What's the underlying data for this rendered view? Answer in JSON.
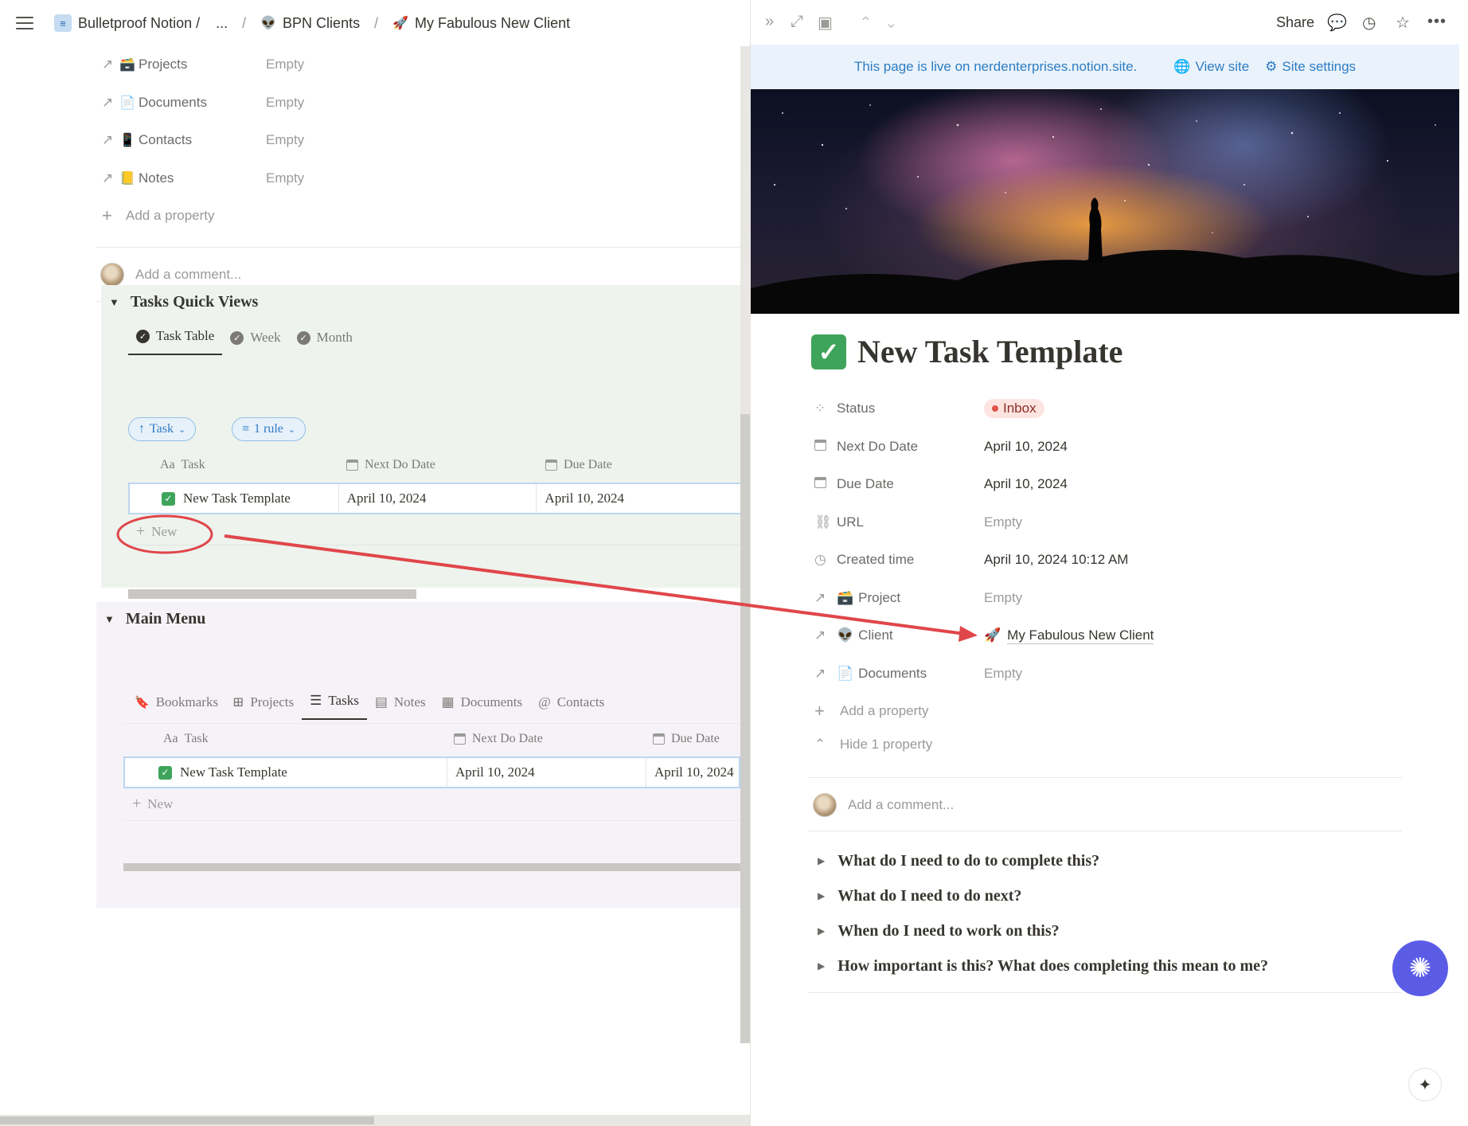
{
  "topbar": {
    "breadcrumbs": [
      {
        "label": "Bulletproof Notion /",
        "icon": "database-icon"
      },
      {
        "label": "...",
        "icon": ""
      },
      {
        "label": "BPN Clients",
        "icon": "alien-icon"
      },
      {
        "label": "My Fabulous New Client",
        "icon": "rocket-icon"
      }
    ],
    "separator": "/"
  },
  "left": {
    "properties": [
      {
        "emoji": "🗃️",
        "label": "Projects",
        "value": "Empty"
      },
      {
        "emoji": "📄",
        "label": "Documents",
        "value": "Empty"
      },
      {
        "emoji": "📱",
        "label": "Contacts",
        "value": "Empty"
      },
      {
        "emoji": "📒",
        "label": "Notes",
        "value": "Empty"
      }
    ],
    "add_property": "Add a property",
    "comment_placeholder": "Add a comment...",
    "tasks_quick_views": {
      "title": "Tasks Quick Views",
      "tabs": [
        "Task Table",
        "Week",
        "Month"
      ],
      "sort_pill": "Task",
      "filter_pill": "1 rule",
      "columns": [
        "Task",
        "Next Do Date",
        "Due Date"
      ],
      "rows": [
        {
          "task": "New Task Template",
          "next_do": "April 10, 2024",
          "due": "April 10, 2024"
        }
      ],
      "new_label": "New"
    },
    "main_menu": {
      "title": "Main Menu",
      "tabs": [
        "Bookmarks",
        "Projects",
        "Tasks",
        "Notes",
        "Documents",
        "Contacts"
      ],
      "columns": [
        "Task",
        "Next Do Date",
        "Due Date"
      ],
      "rows": [
        {
          "task": "New Task Template",
          "next_do": "April 10, 2024",
          "due": "April 10, 2024"
        }
      ],
      "new_label": "New"
    }
  },
  "right": {
    "share": "Share",
    "banner_text": "This page is live on nerdenterprises.notion.site.",
    "view_site": "View site",
    "site_settings": "Site settings",
    "title": "New Task Template",
    "properties": [
      {
        "icon": "status-icon",
        "glyph": "⁘",
        "label": "Status",
        "value": "Inbox",
        "kind": "status"
      },
      {
        "icon": "calendar-icon",
        "glyph": "",
        "label": "Next Do Date",
        "value": "April 10, 2024",
        "kind": "text"
      },
      {
        "icon": "calendar-icon",
        "glyph": "",
        "label": "Due Date",
        "value": "April 10, 2024",
        "kind": "text"
      },
      {
        "icon": "link-icon",
        "glyph": "🔗",
        "label": "URL",
        "value": "Empty",
        "kind": "empty"
      },
      {
        "icon": "clock-icon",
        "glyph": "◷",
        "label": "Created time",
        "value": "April 10, 2024 10:12 AM",
        "kind": "text"
      },
      {
        "icon": "relation-arrow-icon",
        "glyph": "↗",
        "label": "Project",
        "emoji": "🗃️",
        "value": "Empty",
        "kind": "empty"
      },
      {
        "icon": "relation-arrow-icon",
        "glyph": "↗",
        "label": "Client",
        "emoji": "👽",
        "value": "My Fabulous New Client",
        "value_emoji": "🚀",
        "kind": "relation"
      },
      {
        "icon": "relation-arrow-icon",
        "glyph": "↗",
        "label": "Documents",
        "emoji": "📄",
        "value": "Empty",
        "kind": "empty"
      }
    ],
    "add_property": "Add a property",
    "hide_property": "Hide 1 property",
    "comment_placeholder": "Add a comment...",
    "toggles": [
      "What do I need to do to complete this?",
      "What do I need to do next?",
      "When do I need to work on this?",
      "How important is this? What does completing this mean to me?"
    ]
  },
  "colors": {
    "annotation_red": "#e0464a",
    "link_blue": "#2e7cc4",
    "ai_button": "#5b5ce6"
  }
}
